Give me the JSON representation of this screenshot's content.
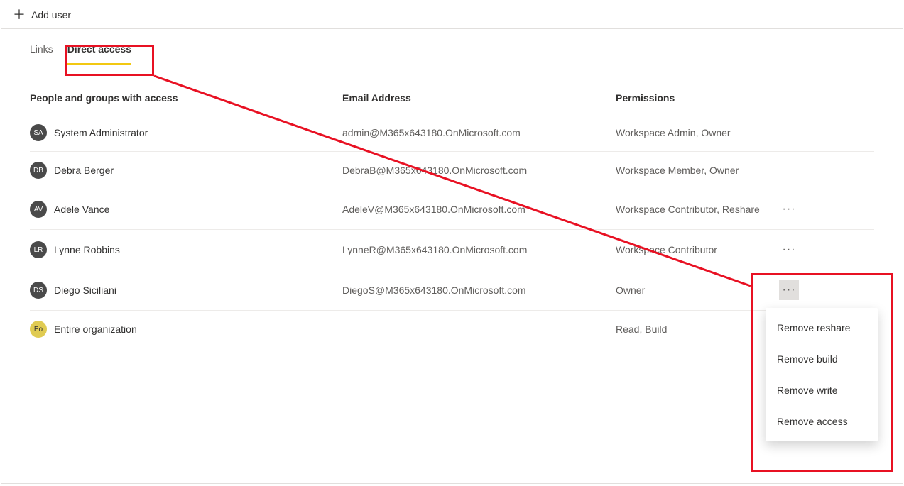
{
  "toolbar": {
    "add_user": "Add user"
  },
  "tabs": {
    "links": "Links",
    "direct_access": "Direct access"
  },
  "columns": {
    "name": "People and groups with access",
    "email": "Email Address",
    "perm": "Permissions"
  },
  "rows": [
    {
      "initials": "SA",
      "name": "System Administrator",
      "email": "admin@M365x643180.OnMicrosoft.com",
      "perm": "Workspace Admin, Owner",
      "has_menu": false
    },
    {
      "initials": "DB",
      "name": "Debra Berger",
      "email": "DebraB@M365x643180.OnMicrosoft.com",
      "perm": "Workspace Member, Owner",
      "has_menu": false
    },
    {
      "initials": "AV",
      "name": "Adele Vance",
      "email": "AdeleV@M365x643180.OnMicrosoft.com",
      "perm": "Workspace Contributor, Reshare",
      "has_menu": true
    },
    {
      "initials": "LR",
      "name": "Lynne Robbins",
      "email": "LynneR@M365x643180.OnMicrosoft.com",
      "perm": "Workspace Contributor",
      "has_menu": true
    },
    {
      "initials": "DS",
      "name": "Diego Siciliani",
      "email": "DiegoS@M365x643180.OnMicrosoft.com",
      "perm": "Owner",
      "has_menu": true,
      "menu_active": true
    },
    {
      "initials": "Eo",
      "name": "Entire organization",
      "email": "",
      "perm": "Read, Build",
      "has_menu": false,
      "eo": true
    }
  ],
  "context_menu": {
    "remove_reshare": "Remove reshare",
    "remove_build": "Remove build",
    "remove_write": "Remove write",
    "remove_access": "Remove access"
  }
}
